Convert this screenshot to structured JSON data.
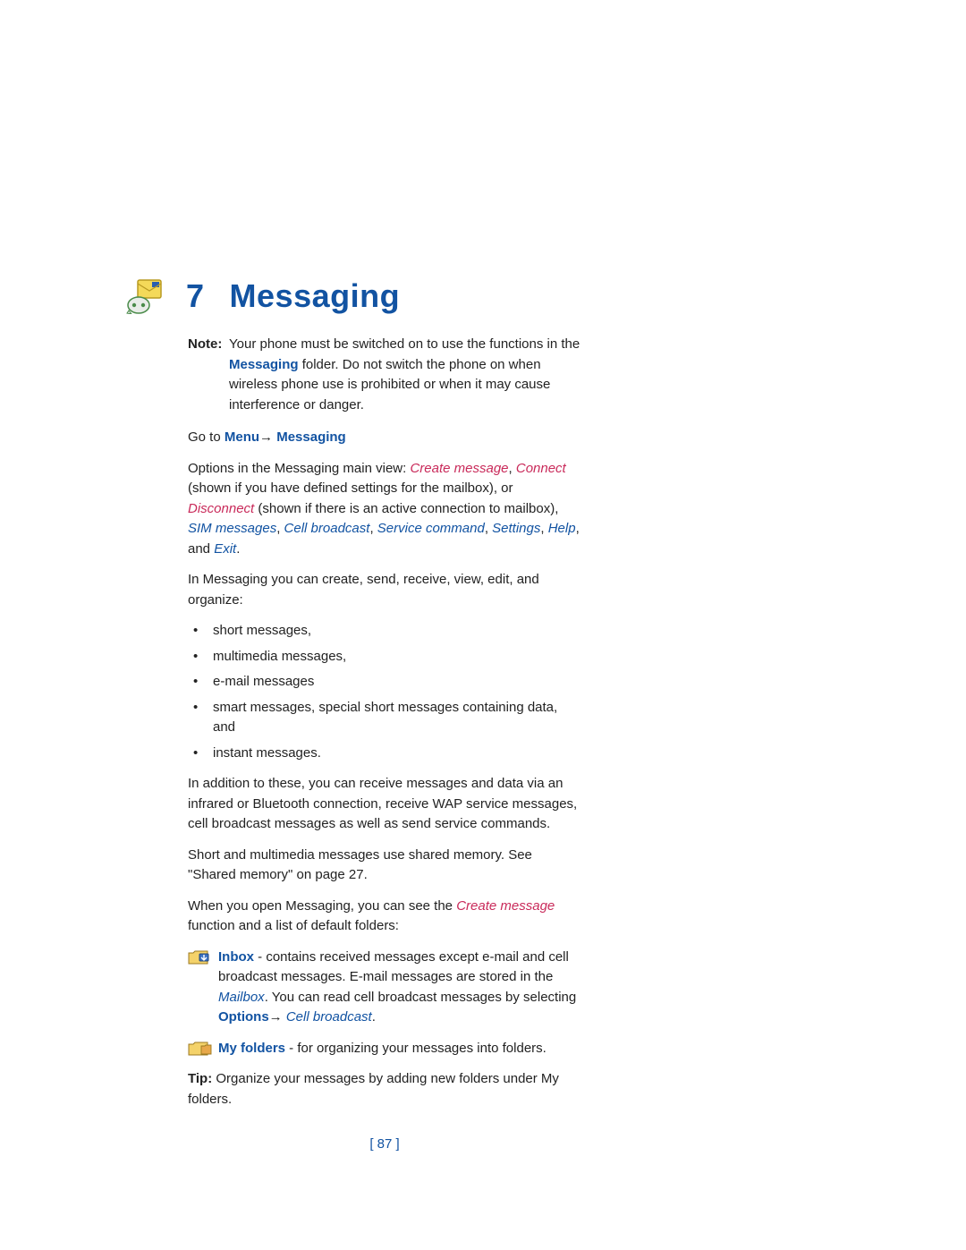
{
  "chapter": {
    "number": "7",
    "title": "Messaging"
  },
  "note": {
    "label": "Note:",
    "text_pre": "Your phone must be switched on to use the functions in the ",
    "text_bold": "Messaging",
    "text_post": " folder.  Do not switch the phone on when wireless phone use is prohibited or when it may cause interference or danger."
  },
  "goto": {
    "pre": "Go to ",
    "menu": "Menu",
    "arrow": "→",
    "target": " Messaging"
  },
  "options_para": {
    "pre": "Options in the Messaging main view: ",
    "create_msg": "Create message",
    "sep1": ", ",
    "connect": "Connect",
    "mid1": " (shown if you have defined settings for the mailbox), or ",
    "disconnect": "Disconnect",
    "mid2": " (shown if there is an active connection to mailbox), ",
    "sim": "SIM messages",
    "sep2": ", ",
    "cell": "Cell broadcast",
    "sep3": ", ",
    "service_cmd": "Service command",
    "sep4": ", ",
    "settings": "Settings",
    "sep5": ", ",
    "help": "Help",
    "sep6": ", and ",
    "exit": "Exit",
    "end": "."
  },
  "intro": "In Messaging you can create, send, receive, view, edit, and organize:",
  "bullets": [
    "short messages,",
    "multimedia messages,",
    "e-mail messages",
    "smart messages, special short messages containing data, and",
    "instant messages."
  ],
  "para_infrared": "In addition to these, you can receive messages and data via an infrared or Bluetooth connection, receive WAP service messages, cell broadcast messages as well as send service commands.",
  "para_shared": "Short and multimedia messages use shared memory.  See \"Shared memory\" on page 27.",
  "para_open": {
    "pre": "When you open Messaging, you can see the ",
    "create": "Create message",
    "post": " function and a list of default folders:"
  },
  "inbox": {
    "label": "Inbox",
    "pre": " - contains received messages except e-mail and cell broadcast messages. E-mail messages are stored in the ",
    "mailbox": "Mailbox",
    "mid": ". You can read cell broadcast messages by selecting ",
    "options": "Options",
    "arrow": "→",
    "cell": " Cell broadcast",
    "end": "."
  },
  "myfolders": {
    "label": "My folders",
    "text": " - for organizing your messages into folders."
  },
  "tip": {
    "label": "Tip:",
    "text": " Organize your messages by adding new folders under My folders."
  },
  "page_number": "[ 87 ]"
}
